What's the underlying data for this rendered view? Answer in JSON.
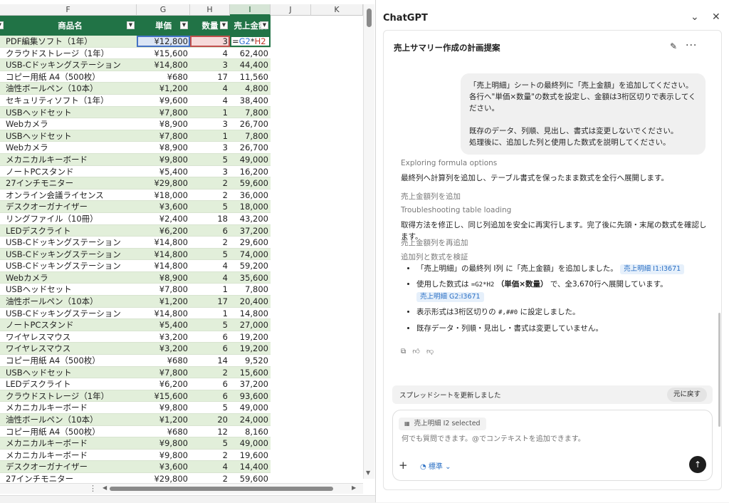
{
  "sheet": {
    "columns": [
      "F",
      "G",
      "H",
      "I",
      "J",
      "K"
    ],
    "header": {
      "product": "商品名",
      "price": "単価",
      "qty": "数量",
      "amount": "売上金額"
    },
    "formula_parts": {
      "eq": "=",
      "g": "G2",
      "op": "*",
      "h": "H2"
    },
    "rows": [
      {
        "name": "PDF編集ソフト（1年）",
        "price": "¥12,800",
        "qty": "3",
        "amount": ""
      },
      {
        "name": "クラウドストレージ（1年）",
        "price": "¥15,600",
        "qty": "4",
        "amount": "62,400"
      },
      {
        "name": "USB-Cドッキングステーション",
        "price": "¥14,800",
        "qty": "3",
        "amount": "44,400"
      },
      {
        "name": "コピー用紙 A4（500枚）",
        "price": "¥680",
        "qty": "17",
        "amount": "11,560"
      },
      {
        "name": "油性ボールペン（10本）",
        "price": "¥1,200",
        "qty": "4",
        "amount": "4,800"
      },
      {
        "name": "セキュリティソフト（1年）",
        "price": "¥9,600",
        "qty": "4",
        "amount": "38,400"
      },
      {
        "name": "USBヘッドセット",
        "price": "¥7,800",
        "qty": "1",
        "amount": "7,800"
      },
      {
        "name": "Webカメラ",
        "price": "¥8,900",
        "qty": "3",
        "amount": "26,700"
      },
      {
        "name": "USBヘッドセット",
        "price": "¥7,800",
        "qty": "1",
        "amount": "7,800"
      },
      {
        "name": "Webカメラ",
        "price": "¥8,900",
        "qty": "3",
        "amount": "26,700"
      },
      {
        "name": "メカニカルキーボード",
        "price": "¥9,800",
        "qty": "5",
        "amount": "49,000"
      },
      {
        "name": "ノートPCスタンド",
        "price": "¥5,400",
        "qty": "3",
        "amount": "16,200"
      },
      {
        "name": "27インチモニター",
        "price": "¥29,800",
        "qty": "2",
        "amount": "59,600"
      },
      {
        "name": "オンライン会議ライセンス",
        "price": "¥18,000",
        "qty": "2",
        "amount": "36,000"
      },
      {
        "name": "デスクオーガナイザー",
        "price": "¥3,600",
        "qty": "5",
        "amount": "18,000"
      },
      {
        "name": "リングファイル（10冊）",
        "price": "¥2,400",
        "qty": "18",
        "amount": "43,200"
      },
      {
        "name": "LEDデスクライト",
        "price": "¥6,200",
        "qty": "6",
        "amount": "37,200"
      },
      {
        "name": "USB-Cドッキングステーション",
        "price": "¥14,800",
        "qty": "2",
        "amount": "29,600"
      },
      {
        "name": "USB-Cドッキングステーション",
        "price": "¥14,800",
        "qty": "5",
        "amount": "74,000"
      },
      {
        "name": "USB-Cドッキングステーション",
        "price": "¥14,800",
        "qty": "4",
        "amount": "59,200"
      },
      {
        "name": "Webカメラ",
        "price": "¥8,900",
        "qty": "4",
        "amount": "35,600"
      },
      {
        "name": "USBヘッドセット",
        "price": "¥7,800",
        "qty": "1",
        "amount": "7,800"
      },
      {
        "name": "油性ボールペン（10本）",
        "price": "¥1,200",
        "qty": "17",
        "amount": "20,400"
      },
      {
        "name": "USB-Cドッキングステーション",
        "price": "¥14,800",
        "qty": "1",
        "amount": "14,800"
      },
      {
        "name": "ノートPCスタンド",
        "price": "¥5,400",
        "qty": "5",
        "amount": "27,000"
      },
      {
        "name": "ワイヤレスマウス",
        "price": "¥3,200",
        "qty": "6",
        "amount": "19,200"
      },
      {
        "name": "ワイヤレスマウス",
        "price": "¥3,200",
        "qty": "6",
        "amount": "19,200"
      },
      {
        "name": "コピー用紙 A4（500枚）",
        "price": "¥680",
        "qty": "14",
        "amount": "9,520"
      },
      {
        "name": "USBヘッドセット",
        "price": "¥7,800",
        "qty": "2",
        "amount": "15,600"
      },
      {
        "name": "LEDデスクライト",
        "price": "¥6,200",
        "qty": "6",
        "amount": "37,200"
      },
      {
        "name": "クラウドストレージ（1年）",
        "price": "¥15,600",
        "qty": "6",
        "amount": "93,600"
      },
      {
        "name": "メカニカルキーボード",
        "price": "¥9,800",
        "qty": "5",
        "amount": "49,000"
      },
      {
        "name": "油性ボールペン（10本）",
        "price": "¥1,200",
        "qty": "20",
        "amount": "24,000"
      },
      {
        "name": "コピー用紙 A4（500枚）",
        "price": "¥680",
        "qty": "12",
        "amount": "8,160"
      },
      {
        "name": "メカニカルキーボード",
        "price": "¥9,800",
        "qty": "5",
        "amount": "49,000"
      },
      {
        "name": "メカニカルキーボード",
        "price": "¥9,800",
        "qty": "2",
        "amount": "19,600"
      },
      {
        "name": "デスクオーガナイザー",
        "price": "¥3,600",
        "qty": "4",
        "amount": "14,400"
      },
      {
        "name": "27インチモニター",
        "price": "¥29,800",
        "qty": "2",
        "amount": "59,600"
      }
    ]
  },
  "chat": {
    "app_title": "ChatGPT",
    "conversation_title": "売上サマリー作成の計画提案",
    "user_message": {
      "line1": "「売上明細」シートの最終列に「売上金額」を追加してください。",
      "line2": "各行へ\"単価×数量\"の数式を設定し、金額は3桁区切りで表示してください。",
      "line3": "既存のデータ、列順、見出し、書式は変更しないでください。",
      "line4": "処理後に、追加した列と使用した数式を説明してください。"
    },
    "step1": "Exploring formula options",
    "text1": "最終列へ計算列を追加し、テーブル書式を保ったまま数式を全行へ展開します。",
    "step2": "売上金額列を追加",
    "step3": "Troubleshooting table loading",
    "text2": "取得方法を修正し、同じ列追加を安全に再実行します。完了後に先頭・末尾の数式を確認します。",
    "step4": "売上金額列を再追加",
    "step5": "追加列と数式を検証",
    "bullets": {
      "b1_text": "「売上明細」の最終列 I列 に「売上金額」を追加しました。",
      "b1_chip": "売上明細 I1:I3671",
      "b2_pre": "使用した数式は",
      "b2_code": "=G2*H2",
      "b2_mid": "（単価×数量）",
      "b2_post": "で、全3,670行へ展開しています。",
      "b2_chip": "売上明細 G2:I3671",
      "b3_pre": "表示形式は3桁区切りの",
      "b3_code": "#,##0",
      "b3_post": "に設定しました。",
      "b4": "既存データ・列順・見出し・書式は変更していません。"
    },
    "update_text": "スプレッドシートを更新しました",
    "undo_label": "元に戻す",
    "selection_chip": "売上明細 I2 selected",
    "input_placeholder": "何でも質問できます。@でコンテキストを追加できます。",
    "mode_label": "標準"
  }
}
